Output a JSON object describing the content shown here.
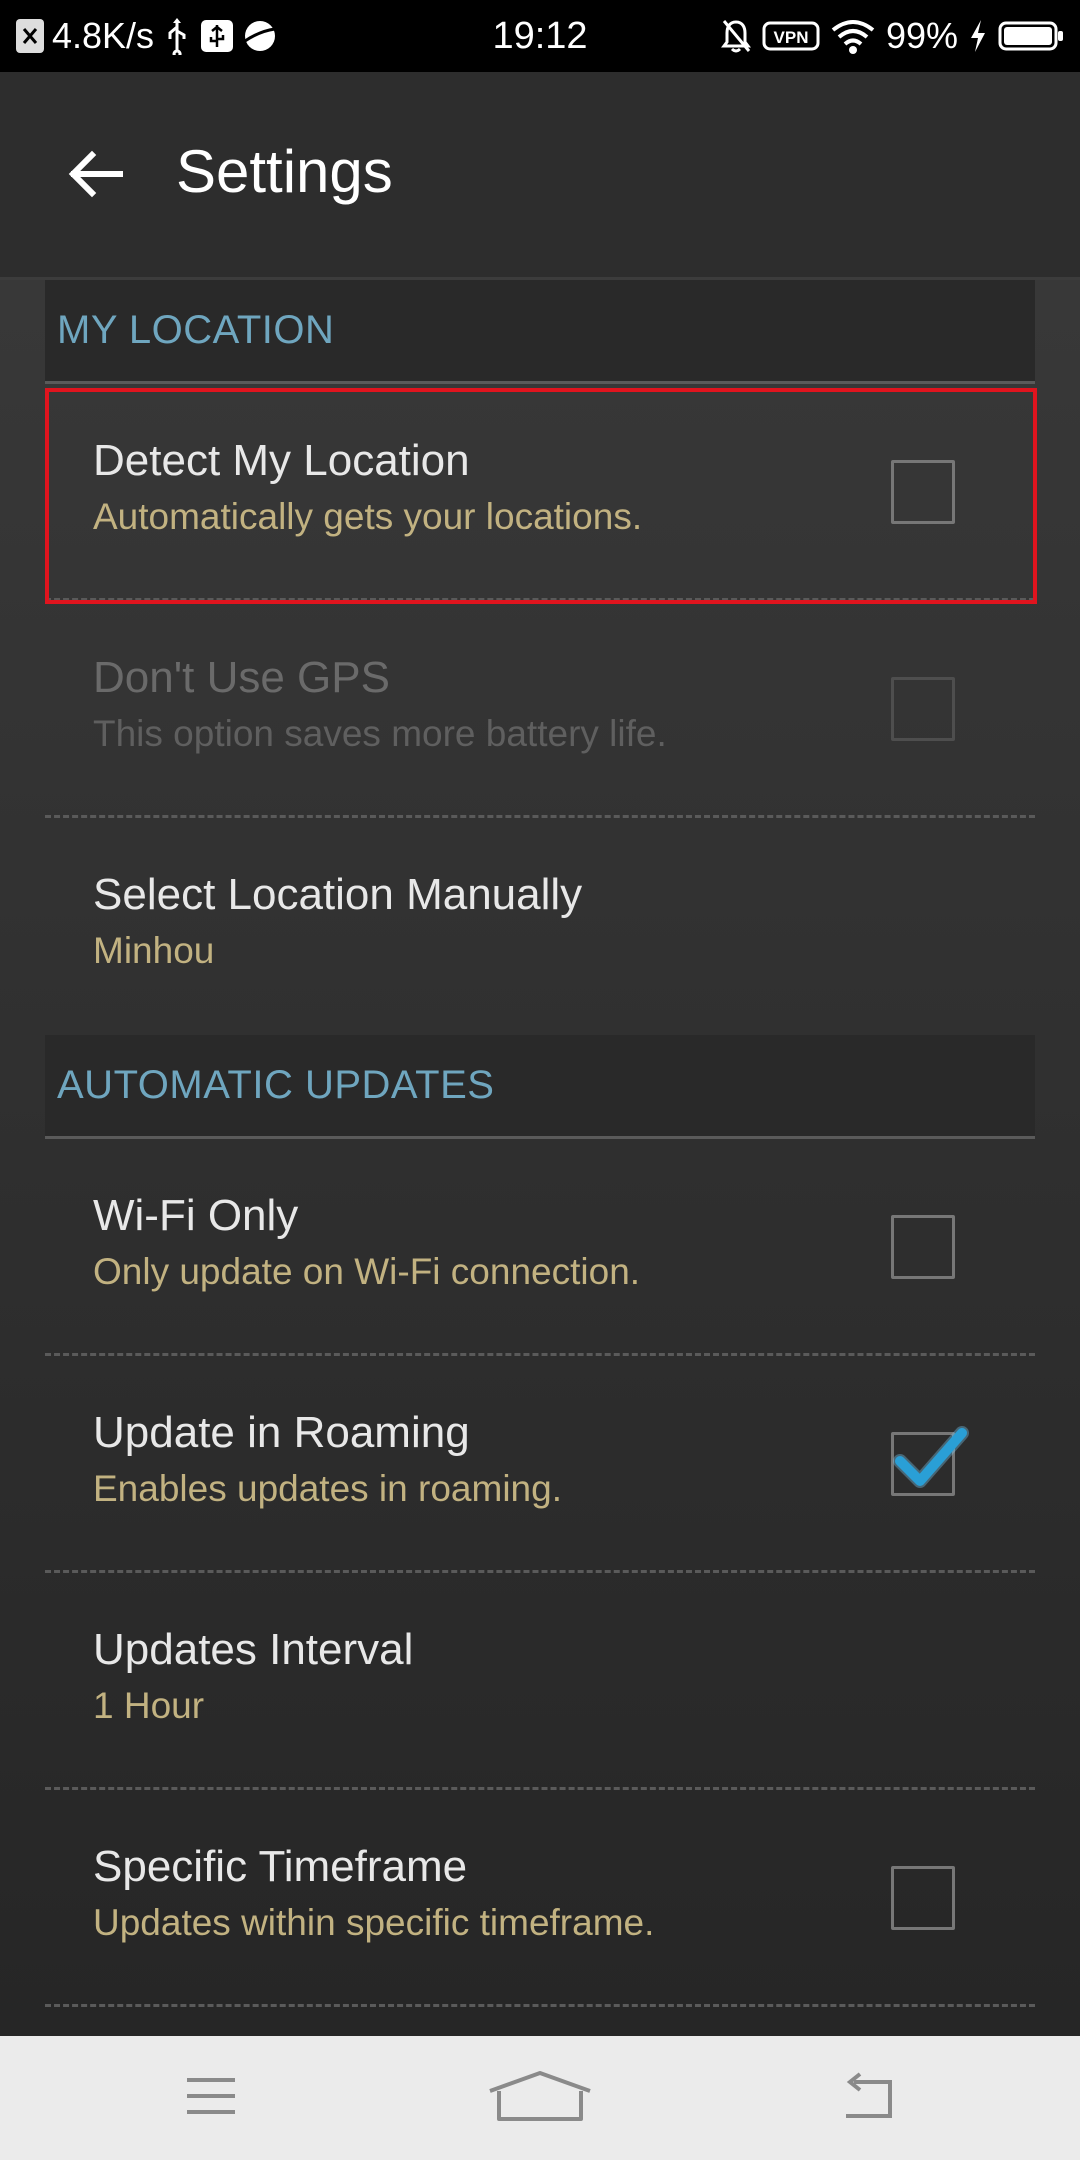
{
  "status_bar": {
    "network_speed": "4.8K/s",
    "time": "19:12",
    "vpn_label": "VPN",
    "battery_percent": "99%",
    "icons": [
      "close-notification-icon",
      "usb-icon",
      "usb-debug-icon",
      "browser-icon",
      "bell-off-icon",
      "vpn-icon",
      "wifi-icon",
      "charging-icon",
      "battery-icon"
    ]
  },
  "app_bar": {
    "title": "Settings",
    "back_icon": "arrow-left-icon"
  },
  "sections": [
    {
      "header": "MY LOCATION",
      "items": [
        {
          "title": "Detect My Location",
          "summary": "Automatically gets your locations.",
          "type": "checkbox",
          "checked": false,
          "enabled": true,
          "highlighted": true
        },
        {
          "title": "Don't Use GPS",
          "summary": "This option saves more battery life.",
          "type": "checkbox",
          "checked": false,
          "enabled": false
        },
        {
          "title": "Select Location Manually",
          "summary": "Minhou",
          "type": "value",
          "enabled": true
        }
      ]
    },
    {
      "header": "AUTOMATIC UPDATES",
      "items": [
        {
          "title": "Wi-Fi Only",
          "summary": "Only update on Wi-Fi connection.",
          "type": "checkbox",
          "checked": false,
          "enabled": true
        },
        {
          "title": "Update in Roaming",
          "summary": "Enables updates in roaming.",
          "type": "checkbox",
          "checked": true,
          "enabled": true
        },
        {
          "title": "Updates Interval",
          "summary": "1 Hour",
          "type": "value",
          "enabled": true
        },
        {
          "title": "Specific Timeframe",
          "summary": "Updates within specific timeframe.",
          "type": "checkbox",
          "checked": false,
          "enabled": true
        }
      ]
    }
  ],
  "colors": {
    "section_header_text": "#6fa6bf",
    "summary_text": "#c2b281",
    "checkmark": "#2a9fd6",
    "highlight_border": "#e0141e"
  },
  "nav_bar": {
    "icons": [
      "menu-icon",
      "home-icon",
      "back-nav-icon"
    ]
  }
}
